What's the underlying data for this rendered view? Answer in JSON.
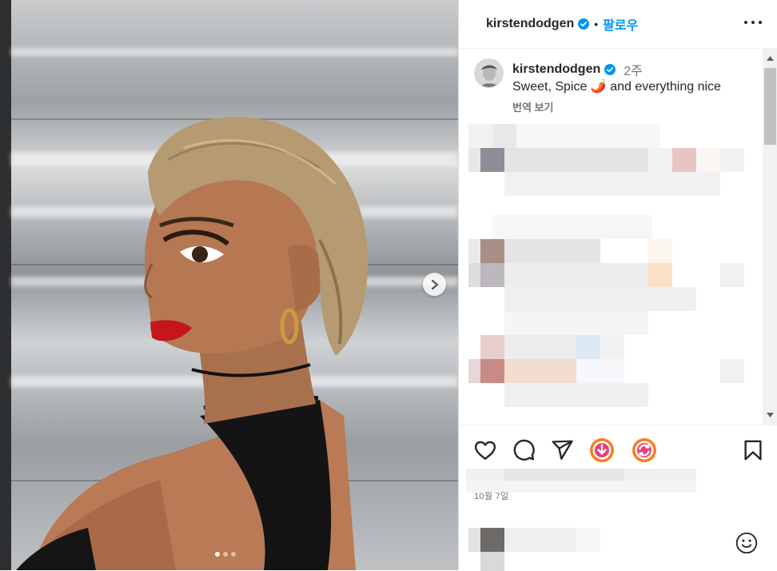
{
  "post": {
    "username": "kirstendodgen",
    "verified_icon": "verified-badge-icon",
    "separator": "•",
    "follow_label": "팔로우",
    "more_icon": "more-options-icon"
  },
  "caption": {
    "username": "kirstendodgen",
    "time_ago": "2주",
    "text": "Sweet, Spice 🌶️ and everything nice",
    "translate_label": "번역 보기"
  },
  "carousel": {
    "next_icon": "chevron-right-icon",
    "slide_count": 3,
    "active_slide": 1
  },
  "actions": {
    "like_icon": "heart-icon",
    "comment_icon": "comment-bubble-icon",
    "share_icon": "paper-plane-icon",
    "download_icon": "download-extension-icon",
    "repost_icon": "repost-extension-icon",
    "save_icon": "bookmark-icon",
    "emoji_icon": "emoji-smile-icon"
  },
  "date_label": "10월 7일",
  "colors": {
    "accent": "#0095f6",
    "text": "#262626",
    "muted": "#737373",
    "extension_orange": "#ff7a1a",
    "extension_pink": "#e8407a"
  }
}
